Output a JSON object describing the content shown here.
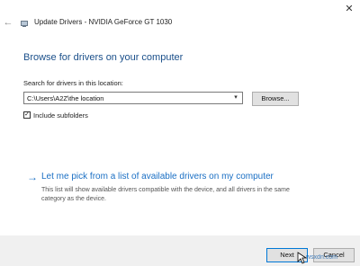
{
  "window": {
    "title": "Update Drivers - NVIDIA GeForce GT 1030",
    "close_glyph": "✕",
    "back_glyph": "←"
  },
  "main": {
    "heading": "Browse for drivers on your computer",
    "search_label": "Search for drivers in this location:",
    "path_value": "C:\\Users\\A2Z\\the location",
    "browse_label": "Browse...",
    "include_subfolders_label": "Include subfolders",
    "include_subfolders_checked": true,
    "pick_link": "Let me pick from a list of available drivers on my computer",
    "pick_description": "This list will show available drivers compatible with the device, and all drivers in the same category as the device."
  },
  "footer": {
    "next_label": "Next",
    "cancel_label": "Cancel"
  },
  "watermark": {
    "text": "wsxdn.com"
  },
  "colors": {
    "heading": "#1a4f8a",
    "link": "#1a6fc4",
    "footer_bg": "#f0f0f0",
    "focus_border": "#0078d7"
  }
}
